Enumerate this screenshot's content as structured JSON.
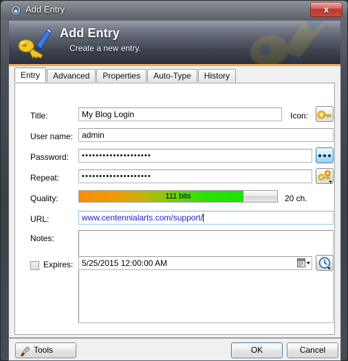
{
  "window": {
    "title": "Add Entry",
    "title_icon": "lock-icon",
    "close_label": "x"
  },
  "banner": {
    "icon": "key-pencil-icon",
    "title": "Add Entry",
    "subtitle": "Create a new entry."
  },
  "tabs": [
    {
      "label": "Entry",
      "active": true
    },
    {
      "label": "Advanced",
      "active": false
    },
    {
      "label": "Properties",
      "active": false
    },
    {
      "label": "Auto-Type",
      "active": false
    },
    {
      "label": "History",
      "active": false
    }
  ],
  "form": {
    "title": {
      "label": "Title:",
      "value": "My Blog Login"
    },
    "icon": {
      "label": "Icon:",
      "button_icon": "key-icon"
    },
    "username": {
      "label": "User name:",
      "value": "admin"
    },
    "password": {
      "label": "Password:",
      "value": "••••••••••••••••••••",
      "button_icon": "three-dots-icon"
    },
    "repeat": {
      "label": "Repeat:",
      "value": "••••••••••••••••••••",
      "button_icon": "key-gear-icon"
    },
    "quality": {
      "label": "Quality:",
      "bits_text": "111 bits",
      "chars_text": "20 ch.",
      "percent": 83,
      "gradient_start": "#f98d07",
      "gradient_end": "#20e000"
    },
    "url": {
      "label": "URL:",
      "value": "www.centennialarts.com/support/",
      "text_color": "#1a1ad8"
    },
    "notes": {
      "label": "Notes:",
      "value": ""
    },
    "expires": {
      "label": "Expires:",
      "checked": false,
      "value": "5/25/2015 12:00:00 AM",
      "dropdown_icon": "calendar-dropdown-icon",
      "button_icon": "clock-icon"
    }
  },
  "buttons": {
    "tools": {
      "label": "Tools",
      "icon": "tools-icon"
    },
    "ok": {
      "label": "OK",
      "default": true
    },
    "cancel": {
      "label": "Cancel",
      "default": false
    }
  }
}
